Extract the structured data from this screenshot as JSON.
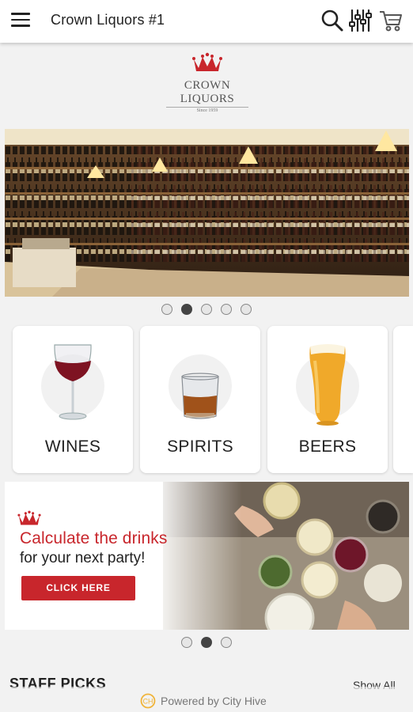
{
  "appbar": {
    "title": "Crown Liquors #1",
    "icons": [
      "menu-icon",
      "search-icon",
      "filter-icon",
      "cart-icon"
    ]
  },
  "logo": {
    "line1": "CROWN",
    "line2": "LIQUORS",
    "since": "Since 1959",
    "color": "#c8262c"
  },
  "hero_carousel": {
    "slide_count": 5,
    "active_index": 1
  },
  "categories": [
    {
      "label": "WINES",
      "icon": "wine-glass-icon"
    },
    {
      "label": "SPIRITS",
      "icon": "whiskey-glass-icon"
    },
    {
      "label": "BEERS",
      "icon": "beer-glass-icon"
    }
  ],
  "promo": {
    "headline": "Calculate the drinks",
    "subline": "for your next party!",
    "cta_label": "CLICK HERE",
    "accent": "#c8262c"
  },
  "promo_carousel": {
    "slide_count": 3,
    "active_index": 1
  },
  "staff_picks": {
    "title": "STAFF PICKS",
    "show_all_label": "Show All"
  },
  "footer": {
    "powered_by": "Powered by City Hive"
  }
}
